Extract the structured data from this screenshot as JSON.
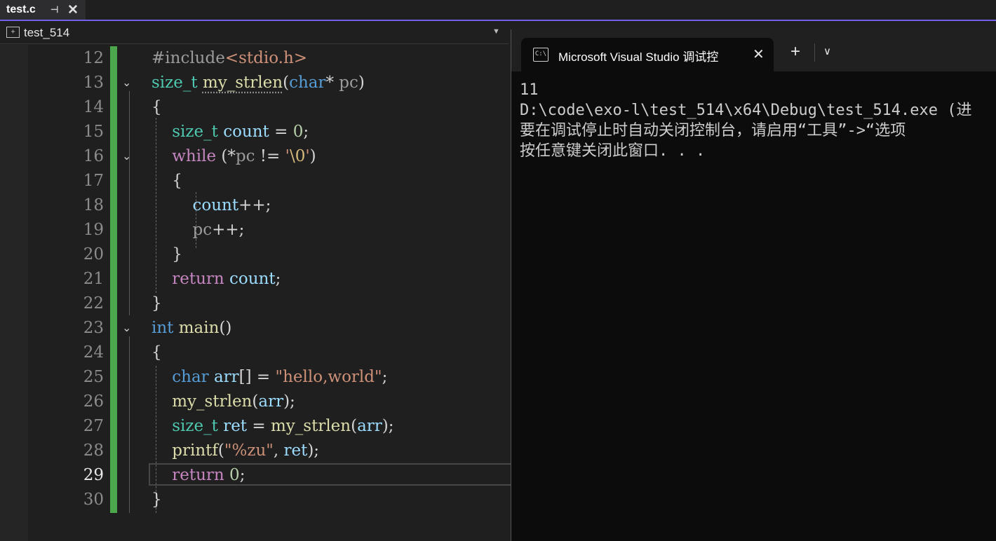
{
  "editor_tab": {
    "filename": "test.c",
    "pin_icon": "pin-icon",
    "close_icon": "close-icon"
  },
  "navbar": {
    "project": "test_514",
    "dropdown_icon": "chevron-down-icon"
  },
  "line_numbers": [
    "12",
    "13",
    "14",
    "15",
    "16",
    "17",
    "18",
    "19",
    "20",
    "21",
    "22",
    "23",
    "24",
    "25",
    "26",
    "27",
    "28",
    "29",
    "30"
  ],
  "active_line": "29",
  "code": {
    "l12_a": "#include",
    "l12_b": "<stdio.h>",
    "l13_a": "size_t",
    "l13_b": "my_strlen",
    "l13_c": "(",
    "l13_d": "char",
    "l13_e": "* ",
    "l13_f": "pc",
    "l13_g": ")",
    "l14": "{",
    "l15_a": "size_t",
    "l15_b": "count",
    "l15_c": " = ",
    "l15_d": "0",
    "l15_e": ";",
    "l16_a": "while",
    "l16_b": " (*",
    "l16_c": "pc",
    "l16_d": " != ",
    "l16_e": "'",
    "l16_f": "\\0",
    "l16_g": "'",
    "l16_h": ")",
    "l17": "{",
    "l18_a": "count",
    "l18_b": "++;",
    "l19_a": "pc",
    "l19_b": "++;",
    "l20": "}",
    "l21_a": "return",
    "l21_b": "count",
    "l21_c": ";",
    "l22": "}",
    "l23_a": "int",
    "l23_b": "main",
    "l23_c": "()",
    "l24": "{",
    "l25_a": "char",
    "l25_b": "arr",
    "l25_c": "[] = ",
    "l25_d": "\"hello,world\"",
    "l25_e": ";",
    "l26_a": "my_strlen",
    "l26_b": "(",
    "l26_c": "arr",
    "l26_d": ");",
    "l27_a": "size_t",
    "l27_b": "ret",
    "l27_c": " = ",
    "l27_d": "my_strlen",
    "l27_e": "(",
    "l27_f": "arr",
    "l27_g": ");",
    "l28_a": "printf",
    "l28_b": "(",
    "l28_c": "\"%zu\"",
    "l28_d": ", ",
    "l28_e": "ret",
    "l28_f": ");",
    "l29_a": "return",
    "l29_b": "0",
    "l29_c": ";",
    "l30": "}"
  },
  "terminal": {
    "tab_title": "Microsoft Visual Studio 调试控",
    "tab_icon_text": "C:\\",
    "new_tab_label": "+",
    "dropdown_label": "⌄",
    "output": [
      "11",
      "D:\\code\\exo-l\\test_514\\x64\\Debug\\test_514.exe (进",
      "要在调试停止时自动关闭控制台，请启用“工具”->“选项",
      "按任意键关闭此窗口. . ."
    ]
  },
  "colors": {
    "keyword": "#569cd6",
    "type": "#4ec9b0",
    "function": "#dcdcaa",
    "variable": "#9cdcfe",
    "control": "#c586c0",
    "number": "#b5cea8",
    "string": "#ce9178",
    "change_bar": "#4ca74c",
    "tab_accent": "#7160e8",
    "terminal_bg": "#0c0c0c"
  }
}
